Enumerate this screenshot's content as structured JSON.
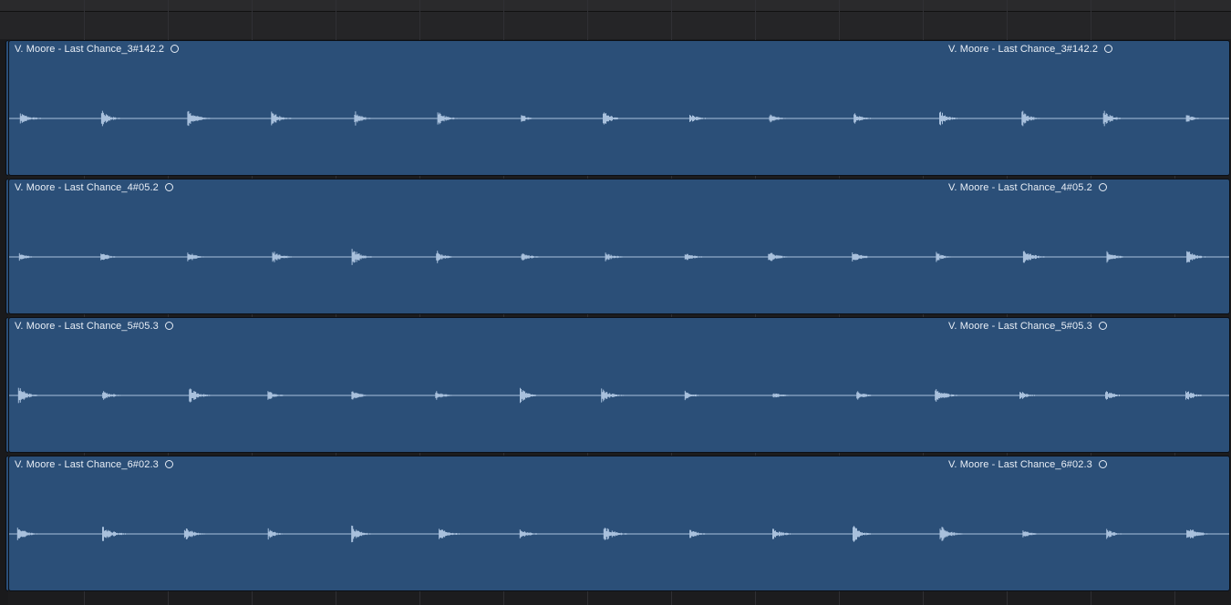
{
  "regions": [
    {
      "name": "V. Moore - Last Chance_3#142.2",
      "repeat_name": "V. Moore - Last Chance_3#142.2"
    },
    {
      "name": "V. Moore - Last Chance_4#05.2",
      "repeat_name": "V. Moore - Last Chance_4#05.2"
    },
    {
      "name": "V. Moore - Last Chance_5#05.3",
      "repeat_name": "V. Moore - Last Chance_5#05.3"
    },
    {
      "name": "V. Moore - Last Chance_6#02.3",
      "repeat_name": "V. Moore - Last Chance_6#02.3"
    }
  ],
  "colors": {
    "region_fill": "#2b4f78",
    "waveform": "#a8c0dc",
    "label_text": "#e8eef6"
  }
}
